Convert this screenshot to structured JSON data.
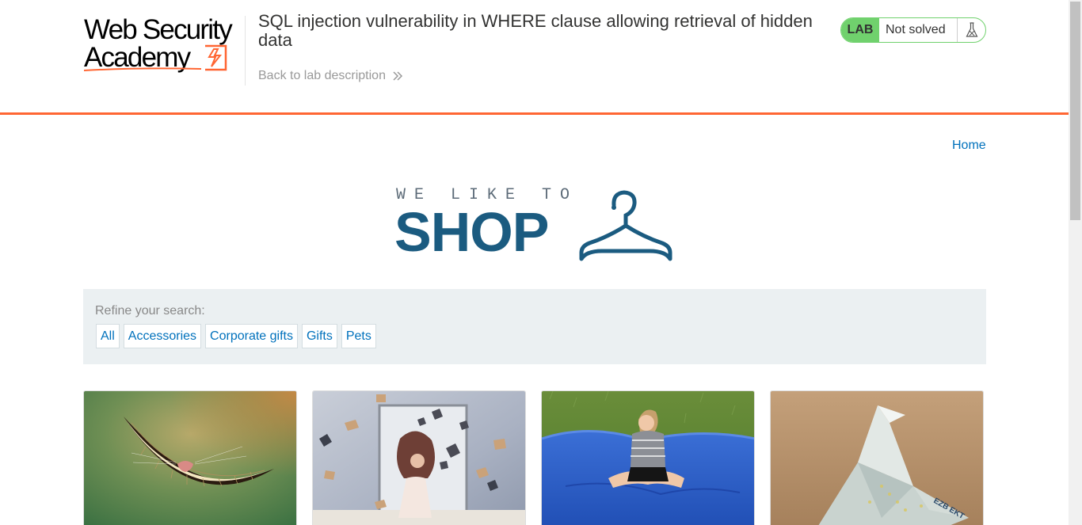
{
  "header": {
    "logo_line1": "Web Security",
    "logo_line2": "Academy",
    "lab_title": "SQL injection vulnerability in WHERE clause allowing retrieval of hidden data",
    "back_link": "Back to lab description",
    "lab_badge": "LAB",
    "lab_status": "Not solved",
    "accent_color": "#ff6633",
    "status_color": "#70d16d"
  },
  "nav": {
    "home": "Home"
  },
  "shop_logo": {
    "tagline": "WE LIKE TO",
    "word": "SHOP",
    "color": "#1b5b80"
  },
  "filters": {
    "label": "Refine your search:",
    "items": [
      "All",
      "Accessories",
      "Corporate gifts",
      "Gifts",
      "Pets"
    ]
  },
  "products": [
    {
      "image": "grinning-mouth-illustration"
    },
    {
      "image": "woman-with-flying-books"
    },
    {
      "image": "girl-on-blue-beanbag"
    },
    {
      "image": "origami-paper-bird"
    }
  ]
}
